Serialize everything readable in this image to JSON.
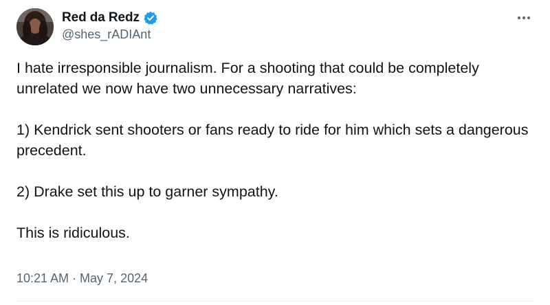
{
  "author": {
    "display_name": "Red da Redz",
    "handle": "@shes_rADIAnt",
    "verified_color": "#1d9bf0"
  },
  "more_icon": "more-horizontal-icon",
  "tweet": {
    "paragraphs": [
      "I hate irresponsible journalism. For a shooting that could be completely unrelated we now have two unnecessary narratives:",
      "1) Kendrick sent shooters or fans ready to ride for him which sets a dangerous precedent.",
      "2) Drake set this up to garner sympathy.",
      "This is ridiculous."
    ],
    "timestamp": "10:21 AM · May 7, 2024"
  }
}
